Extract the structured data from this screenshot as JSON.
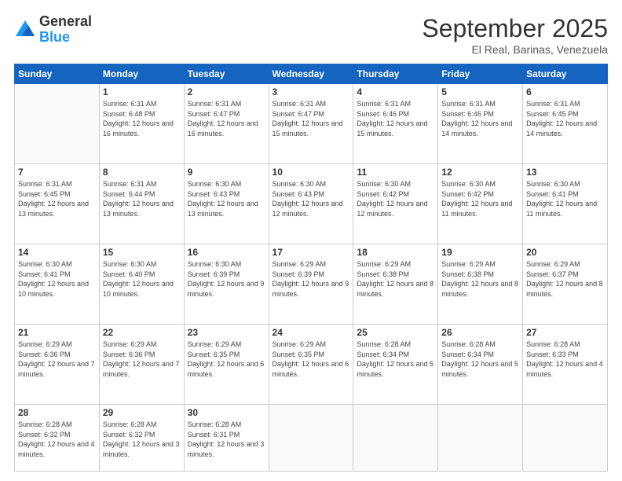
{
  "logo": {
    "general": "General",
    "blue": "Blue"
  },
  "header": {
    "month": "September 2025",
    "location": "El Real, Barinas, Venezuela"
  },
  "days": [
    "Sunday",
    "Monday",
    "Tuesday",
    "Wednesday",
    "Thursday",
    "Friday",
    "Saturday"
  ],
  "weeks": [
    [
      {
        "num": "",
        "sunrise": "",
        "sunset": "",
        "daylight": ""
      },
      {
        "num": "1",
        "sunrise": "Sunrise: 6:31 AM",
        "sunset": "Sunset: 6:48 PM",
        "daylight": "Daylight: 12 hours and 16 minutes."
      },
      {
        "num": "2",
        "sunrise": "Sunrise: 6:31 AM",
        "sunset": "Sunset: 6:47 PM",
        "daylight": "Daylight: 12 hours and 16 minutes."
      },
      {
        "num": "3",
        "sunrise": "Sunrise: 6:31 AM",
        "sunset": "Sunset: 6:47 PM",
        "daylight": "Daylight: 12 hours and 15 minutes."
      },
      {
        "num": "4",
        "sunrise": "Sunrise: 6:31 AM",
        "sunset": "Sunset: 6:46 PM",
        "daylight": "Daylight: 12 hours and 15 minutes."
      },
      {
        "num": "5",
        "sunrise": "Sunrise: 6:31 AM",
        "sunset": "Sunset: 6:46 PM",
        "daylight": "Daylight: 12 hours and 14 minutes."
      },
      {
        "num": "6",
        "sunrise": "Sunrise: 6:31 AM",
        "sunset": "Sunset: 6:45 PM",
        "daylight": "Daylight: 12 hours and 14 minutes."
      }
    ],
    [
      {
        "num": "7",
        "sunrise": "Sunrise: 6:31 AM",
        "sunset": "Sunset: 6:45 PM",
        "daylight": "Daylight: 12 hours and 13 minutes."
      },
      {
        "num": "8",
        "sunrise": "Sunrise: 6:31 AM",
        "sunset": "Sunset: 6:44 PM",
        "daylight": "Daylight: 12 hours and 13 minutes."
      },
      {
        "num": "9",
        "sunrise": "Sunrise: 6:30 AM",
        "sunset": "Sunset: 6:43 PM",
        "daylight": "Daylight: 12 hours and 13 minutes."
      },
      {
        "num": "10",
        "sunrise": "Sunrise: 6:30 AM",
        "sunset": "Sunset: 6:43 PM",
        "daylight": "Daylight: 12 hours and 12 minutes."
      },
      {
        "num": "11",
        "sunrise": "Sunrise: 6:30 AM",
        "sunset": "Sunset: 6:42 PM",
        "daylight": "Daylight: 12 hours and 12 minutes."
      },
      {
        "num": "12",
        "sunrise": "Sunrise: 6:30 AM",
        "sunset": "Sunset: 6:42 PM",
        "daylight": "Daylight: 12 hours and 11 minutes."
      },
      {
        "num": "13",
        "sunrise": "Sunrise: 6:30 AM",
        "sunset": "Sunset: 6:41 PM",
        "daylight": "Daylight: 12 hours and 11 minutes."
      }
    ],
    [
      {
        "num": "14",
        "sunrise": "Sunrise: 6:30 AM",
        "sunset": "Sunset: 6:41 PM",
        "daylight": "Daylight: 12 hours and 10 minutes."
      },
      {
        "num": "15",
        "sunrise": "Sunrise: 6:30 AM",
        "sunset": "Sunset: 6:40 PM",
        "daylight": "Daylight: 12 hours and 10 minutes."
      },
      {
        "num": "16",
        "sunrise": "Sunrise: 6:30 AM",
        "sunset": "Sunset: 6:39 PM",
        "daylight": "Daylight: 12 hours and 9 minutes."
      },
      {
        "num": "17",
        "sunrise": "Sunrise: 6:29 AM",
        "sunset": "Sunset: 6:39 PM",
        "daylight": "Daylight: 12 hours and 9 minutes."
      },
      {
        "num": "18",
        "sunrise": "Sunrise: 6:29 AM",
        "sunset": "Sunset: 6:38 PM",
        "daylight": "Daylight: 12 hours and 8 minutes."
      },
      {
        "num": "19",
        "sunrise": "Sunrise: 6:29 AM",
        "sunset": "Sunset: 6:38 PM",
        "daylight": "Daylight: 12 hours and 8 minutes."
      },
      {
        "num": "20",
        "sunrise": "Sunrise: 6:29 AM",
        "sunset": "Sunset: 6:37 PM",
        "daylight": "Daylight: 12 hours and 8 minutes."
      }
    ],
    [
      {
        "num": "21",
        "sunrise": "Sunrise: 6:29 AM",
        "sunset": "Sunset: 6:36 PM",
        "daylight": "Daylight: 12 hours and 7 minutes."
      },
      {
        "num": "22",
        "sunrise": "Sunrise: 6:29 AM",
        "sunset": "Sunset: 6:36 PM",
        "daylight": "Daylight: 12 hours and 7 minutes."
      },
      {
        "num": "23",
        "sunrise": "Sunrise: 6:29 AM",
        "sunset": "Sunset: 6:35 PM",
        "daylight": "Daylight: 12 hours and 6 minutes."
      },
      {
        "num": "24",
        "sunrise": "Sunrise: 6:29 AM",
        "sunset": "Sunset: 6:35 PM",
        "daylight": "Daylight: 12 hours and 6 minutes."
      },
      {
        "num": "25",
        "sunrise": "Sunrise: 6:28 AM",
        "sunset": "Sunset: 6:34 PM",
        "daylight": "Daylight: 12 hours and 5 minutes."
      },
      {
        "num": "26",
        "sunrise": "Sunrise: 6:28 AM",
        "sunset": "Sunset: 6:34 PM",
        "daylight": "Daylight: 12 hours and 5 minutes."
      },
      {
        "num": "27",
        "sunrise": "Sunrise: 6:28 AM",
        "sunset": "Sunset: 6:33 PM",
        "daylight": "Daylight: 12 hours and 4 minutes."
      }
    ],
    [
      {
        "num": "28",
        "sunrise": "Sunrise: 6:28 AM",
        "sunset": "Sunset: 6:32 PM",
        "daylight": "Daylight: 12 hours and 4 minutes."
      },
      {
        "num": "29",
        "sunrise": "Sunrise: 6:28 AM",
        "sunset": "Sunset: 6:32 PM",
        "daylight": "Daylight: 12 hours and 3 minutes."
      },
      {
        "num": "30",
        "sunrise": "Sunrise: 6:28 AM",
        "sunset": "Sunset: 6:31 PM",
        "daylight": "Daylight: 12 hours and 3 minutes."
      },
      {
        "num": "",
        "sunrise": "",
        "sunset": "",
        "daylight": ""
      },
      {
        "num": "",
        "sunrise": "",
        "sunset": "",
        "daylight": ""
      },
      {
        "num": "",
        "sunrise": "",
        "sunset": "",
        "daylight": ""
      },
      {
        "num": "",
        "sunrise": "",
        "sunset": "",
        "daylight": ""
      }
    ]
  ]
}
